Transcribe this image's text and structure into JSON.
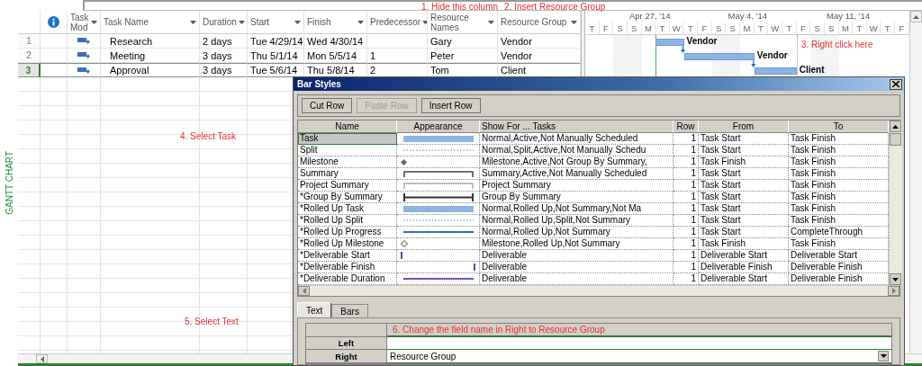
{
  "view_label": "GANTT CHART",
  "annotations": [
    {
      "text": "1. Hide this column"
    },
    {
      "text": "2. Insert Resource Group"
    },
    {
      "text": "3. Right click here"
    },
    {
      "text": "4. Select Task"
    },
    {
      "text": "5. Select Text"
    }
  ],
  "task_table": {
    "columns": [
      {
        "kind": "info"
      },
      {
        "kind": "field",
        "label": "Task Mod"
      },
      {
        "kind": "field",
        "label": "Task Name"
      },
      {
        "kind": "field",
        "label": "Duration"
      },
      {
        "kind": "field",
        "label": "Start"
      },
      {
        "kind": "field",
        "label": "Finish"
      },
      {
        "kind": "field",
        "label": "Predecessor"
      },
      {
        "kind": "field",
        "label": "Resource Names"
      },
      {
        "kind": "field",
        "label": "Resource Group"
      }
    ],
    "rows": [
      {
        "number": "1",
        "selected": false,
        "name": "Research",
        "duration": "2 days",
        "start": "Tue 4/29/14",
        "finish": "Wed 4/30/14",
        "resource_names": "Gary",
        "resource_group": "Vendor"
      },
      {
        "number": "2",
        "selected": false,
        "name": "Meeting",
        "duration": "3 days",
        "start": "Thu 5/1/14",
        "finish": "Mon 5/5/14",
        "predecessor": "1",
        "resource_names": "Peter",
        "resource_group": "Vendor"
      },
      {
        "number": "3",
        "selected": true,
        "name": "Approval",
        "duration": "3 days",
        "start": "Tue 5/6/14",
        "finish": "Thu 5/8/14",
        "predecessor": "2",
        "resource_names": "Tom",
        "resource_group": "Client"
      }
    ]
  },
  "gantt": {
    "weeks": [
      "Apr 27, '14",
      "May 4, '14",
      "May 11, '14"
    ],
    "days": [
      "T",
      "F",
      "S",
      "S",
      "M",
      "T",
      "W",
      "T",
      "F",
      "S",
      "S",
      "M",
      "T",
      "W",
      "T",
      "F",
      "S",
      "S",
      "M",
      "T",
      "W",
      "T",
      "F"
    ],
    "bars": [
      {
        "label": "Vendor"
      },
      {
        "label": "Vendor"
      },
      {
        "label": "Client"
      }
    ]
  },
  "dialog": {
    "title": "Bar Styles",
    "buttons": [
      {
        "label": "Cut Row",
        "disabled": false
      },
      {
        "label": "Paste Row",
        "disabled": true
      },
      {
        "label": "Insert Row",
        "disabled": false
      }
    ],
    "columns": [
      "Name",
      "Appearance",
      "Show For ... Tasks",
      "Row",
      "From",
      "To"
    ],
    "rows": [
      {
        "name": "Task",
        "kind": "bar",
        "show_for": "Normal,Active,Not Manually Scheduled",
        "row": "1",
        "from": "Task Start",
        "to": "Task Finish",
        "selected": true
      },
      {
        "name": "Split",
        "kind": "dotted",
        "show_for": "Normal,Split,Active,Not Manually Schedu",
        "row": "1",
        "from": "Task Start",
        "to": "Task Finish",
        "selected": false
      },
      {
        "name": "Milestone",
        "kind": "diamond",
        "show_for": "Milestone,Active,Not Group By Summary,",
        "row": "1",
        "from": "Task Finish",
        "to": "Task Finish",
        "selected": false
      },
      {
        "name": "Summary",
        "kind": "bracket",
        "show_for": "Summary,Active,Not Manually Scheduled",
        "row": "1",
        "from": "Task Start",
        "to": "Task Finish",
        "selected": false
      },
      {
        "name": "Project Summary",
        "kind": "bracket-light",
        "show_for": "Project Summary",
        "row": "1",
        "from": "Task Start",
        "to": "Task Finish",
        "selected": false
      },
      {
        "name": "*Group By Summary",
        "kind": "bracket-thick",
        "show_for": "Group By Summary",
        "row": "1",
        "from": "Task Start",
        "to": "Task Finish",
        "selected": false
      },
      {
        "name": "*Rolled Up Task",
        "kind": "bar",
        "show_for": "Normal,Rolled Up,Not Summary,Not Ma",
        "row": "1",
        "from": "Task Start",
        "to": "Task Finish",
        "selected": false
      },
      {
        "name": "*Rolled Up Split",
        "kind": "dotted",
        "show_for": "Normal,Rolled Up,Split,Not Summary",
        "row": "1",
        "from": "Task Start",
        "to": "Task Finish",
        "selected": false
      },
      {
        "name": "*Rolled Up Progress",
        "kind": "line",
        "show_for": "Normal,Rolled Up,Not Summary",
        "row": "1",
        "from": "Task Start",
        "to": "CompleteThrough",
        "selected": false
      },
      {
        "name": "*Rolled Up Milestone",
        "kind": "hollow-diamond",
        "show_for": "Milestone,Rolled Up,Not Summary",
        "row": "1",
        "from": "Task Finish",
        "to": "Task Finish",
        "selected": false
      },
      {
        "name": "*Deliverable Start",
        "kind": "tick-start",
        "show_for": "Deliverable",
        "row": "1",
        "from": "Deliverable Start",
        "to": "Deliverable Start",
        "selected": false
      },
      {
        "name": "*Deliverable Finish",
        "kind": "tick-end",
        "show_for": "Deliverable",
        "row": "1",
        "from": "Deliverable Finish",
        "to": "Deliverable Finish",
        "selected": false
      },
      {
        "name": "*Deliverable Duration",
        "kind": "line-purple",
        "show_for": "Deliverable",
        "row": "1",
        "from": "Deliverable Start",
        "to": "Deliverable Finish",
        "selected": false
      }
    ],
    "tabs": [
      {
        "label": "Text",
        "selected": true
      },
      {
        "label": "Bars",
        "selected": false
      }
    ],
    "text_panel": {
      "note": "6. Change the field name in Right to Resource Group",
      "fields": [
        {
          "label": "Left"
        },
        {
          "label": "Right",
          "value": "Resource Group"
        }
      ]
    }
  }
}
